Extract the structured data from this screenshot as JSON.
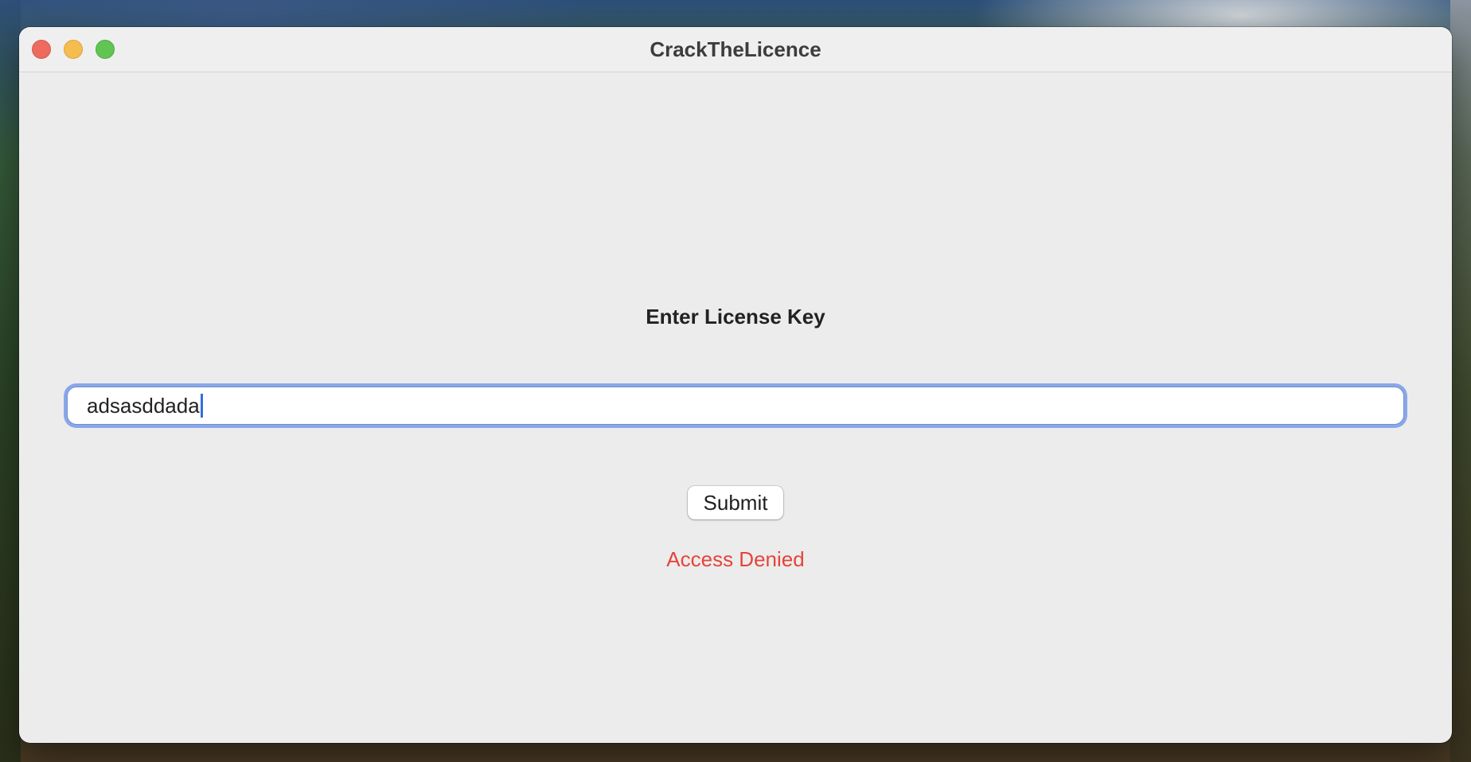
{
  "window": {
    "title": "CrackTheLicence"
  },
  "form": {
    "heading": "Enter License Key",
    "license_input_value": "adsasddada",
    "submit_label": "Submit",
    "status_text": "Access Denied",
    "status_color": "#e5443b",
    "focus_ring_color": "#8aa7e8"
  },
  "icons": {
    "close": "close-icon",
    "minimize": "minimize-icon",
    "zoom": "zoom-icon"
  }
}
